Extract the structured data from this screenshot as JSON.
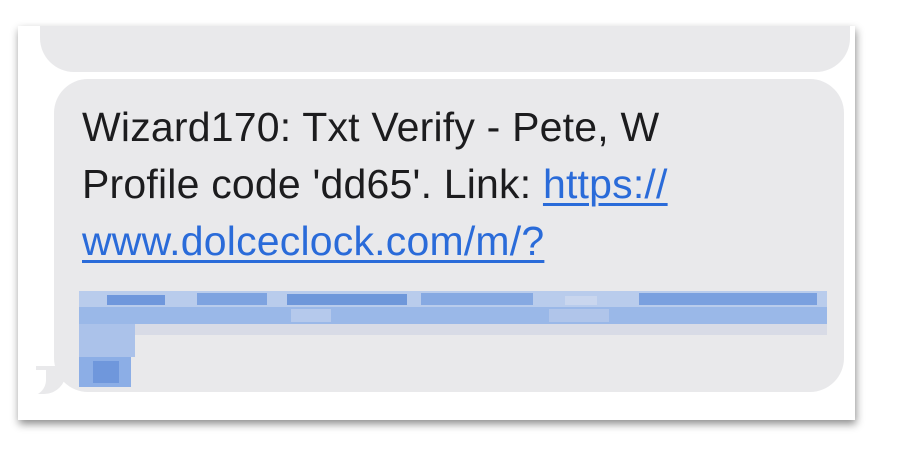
{
  "message": {
    "line1": "Wizard170: Txt Verify - Pete, W",
    "line2_text": "Profile code 'dd65'. Link: ",
    "line2_link": "https://",
    "line3_link": "www.dolceclock.com/m/?"
  },
  "colors": {
    "bubble": "#e9e9eb",
    "text": "#1c1c1e",
    "link": "#2a6bd9"
  }
}
